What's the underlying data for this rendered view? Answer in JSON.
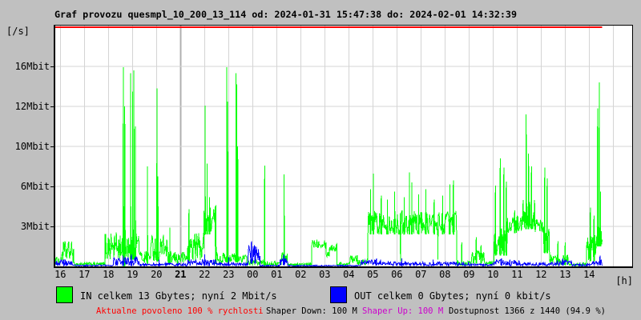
{
  "header": {
    "title": "Graf provozu quesmpl_10_200_13_114 od: 2024-01-31 15:47:38 do: 2024-02-01 14:32:39"
  },
  "legend": {
    "in": {
      "label": "IN celkem 13 Gbytes; nyní 2 Mbit/s",
      "color": "#00ff00"
    },
    "out": {
      "label": "OUT celkem 0 Gbytes; nyní 0 kbit/s",
      "color": "#0000ff"
    }
  },
  "status": {
    "allowed": {
      "text": "Aktualne povoleno 100 % rychlosti",
      "color": "#ff0000"
    },
    "shaper_down": {
      "text": "Shaper Down: 100 M",
      "color": "#000000"
    },
    "shaper_up": {
      "text": "Shaper Up: 100 M",
      "color": "#cc00cc"
    },
    "availability": {
      "text": "Dostupnost 1366 z 1440 (94.9 %)",
      "color": "#000000"
    }
  },
  "chart_data": {
    "type": "line",
    "title": "Graf provozu quesmpl_10_200_13_114 od: 2024-01-31 15:47:38 do: 2024-02-01 14:32:39",
    "grid": true,
    "time_domain_hours": [
      15.79,
      39.79
    ],
    "time_note": "t = hours since 00:00 of 2024-01-31; values >= 24 are 2024-02-01",
    "x_axis": {
      "unit_label": "[h]",
      "hour_ticks": [
        "16",
        "17",
        "18",
        "19",
        "20",
        "21",
        "22",
        "23",
        "00",
        "01",
        "02",
        "03",
        "04",
        "05",
        "06",
        "07",
        "08",
        "09",
        "10",
        "11",
        "12",
        "13",
        "14"
      ],
      "bold_tick": "21"
    },
    "y_axis": {
      "unit_label": "[/s]",
      "ticks": [
        {
          "label": "16Mbit",
          "mbit": 16
        },
        {
          "label": "12Mbit",
          "mbit": 12
        },
        {
          "label": "10Mbit",
          "mbit": 10
        },
        {
          "label": "6Mbit",
          "mbit": 6
        },
        {
          "label": "3Mbit",
          "mbit": 3
        }
      ]
    },
    "ceiling_line": {
      "color": "#ff0000",
      "spans_to_hour": 38.54
    },
    "segment_format": "[t_start, t_end, min_mbit, max_mbit] noisy oscillation band",
    "spike_format": "[t, peak_mbit] narrow needle",
    "series": [
      {
        "name": "IN",
        "color": "#00ff00",
        "unit": "Mbit/s",
        "current": 2,
        "total": "13 Gbytes",
        "segments": [
          [
            15.79,
            16.05,
            0.1,
            0.7
          ],
          [
            16.05,
            16.55,
            0.3,
            1.9
          ],
          [
            16.55,
            17.85,
            0.04,
            0.3
          ],
          [
            17.85,
            18.6,
            0.4,
            2.6
          ],
          [
            18.7,
            19.3,
            0.5,
            2.8
          ],
          [
            19.3,
            19.75,
            0.2,
            1.2
          ],
          [
            19.75,
            20.45,
            0.4,
            2.4
          ],
          [
            20.45,
            21.3,
            0.15,
            1.1
          ],
          [
            21.3,
            21.98,
            0.4,
            2.6
          ],
          [
            21.98,
            22.45,
            2.4,
            4.6
          ],
          [
            22.45,
            22.8,
            0.2,
            1.1
          ],
          [
            22.8,
            23.45,
            0.3,
            1.0
          ],
          [
            23.45,
            23.75,
            0.3,
            0.9
          ],
          [
            23.75,
            24.45,
            0.05,
            0.5
          ],
          [
            24.45,
            25.2,
            0.05,
            0.4
          ],
          [
            25.2,
            25.45,
            0.3,
            1.3
          ],
          [
            25.45,
            26.45,
            0.03,
            0.25
          ],
          [
            26.45,
            27.05,
            1.4,
            2.1
          ],
          [
            27.05,
            27.2,
            0.7,
            1.2
          ],
          [
            27.2,
            27.5,
            1.1,
            1.7
          ],
          [
            27.5,
            28.05,
            0.05,
            0.3
          ],
          [
            28.05,
            28.35,
            0.3,
            1.1
          ],
          [
            28.35,
            28.8,
            0.1,
            0.6
          ],
          [
            28.8,
            32.5,
            2.4,
            4.2
          ],
          [
            32.5,
            33.1,
            0.05,
            0.4
          ],
          [
            33.1,
            33.65,
            0.2,
            1.2
          ],
          [
            33.65,
            34.05,
            0.05,
            0.4
          ],
          [
            34.05,
            34.6,
            0.8,
            3.0
          ],
          [
            34.6,
            35.25,
            2.5,
            3.8
          ],
          [
            35.25,
            35.75,
            2.8,
            5.0
          ],
          [
            35.75,
            36.1,
            2.4,
            3.6
          ],
          [
            36.1,
            36.35,
            1.0,
            3.0
          ],
          [
            36.35,
            37.15,
            0.1,
            0.9
          ],
          [
            37.15,
            37.9,
            0.03,
            0.3
          ],
          [
            37.9,
            38.3,
            0.4,
            2.4
          ],
          [
            38.3,
            38.54,
            1.5,
            3.0
          ]
        ],
        "spikes": [
          [
            18.62,
            15.9
          ],
          [
            18.68,
            12.0
          ],
          [
            18.92,
            15.3
          ],
          [
            19.0,
            13.5
          ],
          [
            19.06,
            15.6
          ],
          [
            19.12,
            11.0
          ],
          [
            19.62,
            8.0
          ],
          [
            20.02,
            13.8
          ],
          [
            20.06,
            7.0
          ],
          [
            20.55,
            2.9
          ],
          [
            21.35,
            4.3
          ],
          [
            22.02,
            12.1
          ],
          [
            22.1,
            8.3
          ],
          [
            22.2,
            5.2
          ],
          [
            22.47,
            4.6
          ],
          [
            22.92,
            15.9
          ],
          [
            22.96,
            12.5
          ],
          [
            23.3,
            15.3
          ],
          [
            23.34,
            14.2
          ],
          [
            23.38,
            10.0
          ],
          [
            24.5,
            8.1
          ],
          [
            25.31,
            7.2
          ],
          [
            28.9,
            5.8
          ],
          [
            29.02,
            7.3
          ],
          [
            29.35,
            5.3
          ],
          [
            29.6,
            5.0
          ],
          [
            29.9,
            5.6
          ],
          [
            30.15,
            0.4
          ],
          [
            30.3,
            5.2
          ],
          [
            30.52,
            7.4
          ],
          [
            30.62,
            6.4
          ],
          [
            30.9,
            5.4
          ],
          [
            31.2,
            5.8
          ],
          [
            31.55,
            5.0
          ],
          [
            31.7,
            0.5
          ],
          [
            31.9,
            5.3
          ],
          [
            32.2,
            6.2
          ],
          [
            32.35,
            6.6
          ],
          [
            32.7,
            1.8
          ],
          [
            33.3,
            2.2
          ],
          [
            33.5,
            1.6
          ],
          [
            34.1,
            6.1
          ],
          [
            34.3,
            8.8
          ],
          [
            34.45,
            7.9
          ],
          [
            34.55,
            6.5
          ],
          [
            34.9,
            4.2
          ],
          [
            35.38,
            11.6
          ],
          [
            35.48,
            9.3
          ],
          [
            35.6,
            8.0
          ],
          [
            36.15,
            7.9
          ],
          [
            36.25,
            6.8
          ],
          [
            36.7,
            1.9
          ],
          [
            37.0,
            1.8
          ],
          [
            38.05,
            4.4
          ],
          [
            38.2,
            3.8
          ],
          [
            38.35,
            11.9
          ],
          [
            38.42,
            14.4
          ],
          [
            38.48,
            5.6
          ]
        ],
        "end_point": [
          38.54,
          2.0
        ]
      },
      {
        "name": "OUT",
        "color": "#0000ff",
        "unit": "kbit/s",
        "current": 0,
        "total": "0 Gbytes",
        "segments": [
          [
            15.79,
            16.5,
            0.05,
            0.5
          ],
          [
            16.5,
            18.2,
            0.02,
            0.12
          ],
          [
            18.2,
            19.3,
            0.05,
            0.7
          ],
          [
            19.3,
            21.3,
            0.02,
            0.25
          ],
          [
            21.3,
            22.5,
            0.05,
            0.55
          ],
          [
            22.5,
            23.8,
            0.02,
            0.3
          ],
          [
            23.8,
            24.3,
            0.2,
            1.6
          ],
          [
            24.3,
            25.15,
            0.01,
            0.1
          ],
          [
            25.15,
            25.45,
            0.1,
            0.6
          ],
          [
            25.45,
            28.5,
            0.01,
            0.1
          ],
          [
            28.5,
            29.4,
            0.1,
            0.5
          ],
          [
            29.4,
            33.0,
            0.03,
            0.35
          ],
          [
            33.0,
            34.0,
            0.02,
            0.2
          ],
          [
            34.0,
            35.1,
            0.05,
            0.5
          ],
          [
            35.1,
            36.4,
            0.03,
            0.3
          ],
          [
            36.4,
            37.3,
            0.05,
            0.45
          ],
          [
            37.3,
            38.1,
            0.02,
            0.2
          ],
          [
            38.1,
            38.54,
            0.1,
            0.5
          ]
        ],
        "spikes": [
          [
            16.15,
            0.55
          ],
          [
            18.6,
            0.8
          ],
          [
            18.95,
            0.9
          ],
          [
            20.1,
            0.5
          ],
          [
            22.0,
            0.9
          ],
          [
            23.0,
            0.7
          ],
          [
            23.95,
            1.9
          ],
          [
            24.1,
            1.5
          ],
          [
            25.3,
            0.9
          ],
          [
            29.15,
            0.6
          ],
          [
            30.2,
            0.6
          ],
          [
            31.5,
            0.5
          ],
          [
            34.35,
            0.6
          ],
          [
            34.7,
            0.5
          ],
          [
            36.9,
            0.6
          ],
          [
            38.45,
            0.8
          ]
        ],
        "end_point": [
          38.54,
          0.05
        ]
      }
    ]
  }
}
